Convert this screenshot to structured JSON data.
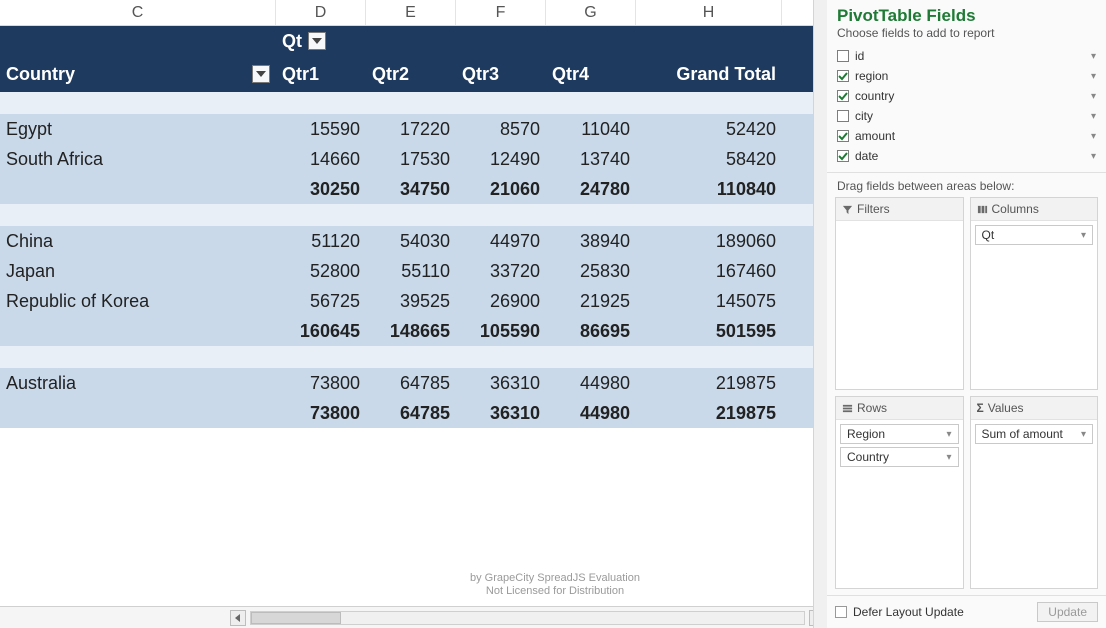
{
  "columns": {
    "C": "C",
    "D": "D",
    "E": "E",
    "F": "F",
    "G": "G",
    "H": "H"
  },
  "pivot_header": {
    "qt_label": "Qt",
    "row_field": "Country",
    "cols": {
      "q1": "Qtr1",
      "q2": "Qtr2",
      "q3": "Qtr3",
      "q4": "Qtr4",
      "total": "Grand Total"
    }
  },
  "groups": [
    {
      "rows": [
        {
          "label": "Egypt",
          "q1": "15590",
          "q2": "17220",
          "q3": "8570",
          "q4": "11040",
          "total": "52420"
        },
        {
          "label": "South Africa",
          "q1": "14660",
          "q2": "17530",
          "q3": "12490",
          "q4": "13740",
          "total": "58420"
        }
      ],
      "subtotal": {
        "q1": "30250",
        "q2": "34750",
        "q3": "21060",
        "q4": "24780",
        "total": "110840"
      }
    },
    {
      "rows": [
        {
          "label": "China",
          "q1": "51120",
          "q2": "54030",
          "q3": "44970",
          "q4": "38940",
          "total": "189060"
        },
        {
          "label": "Japan",
          "q1": "52800",
          "q2": "55110",
          "q3": "33720",
          "q4": "25830",
          "total": "167460"
        },
        {
          "label": "Republic of Korea",
          "q1": "56725",
          "q2": "39525",
          "q3": "26900",
          "q4": "21925",
          "total": "145075"
        }
      ],
      "subtotal": {
        "q1": "160645",
        "q2": "148665",
        "q3": "105590",
        "q4": "86695",
        "total": "501595"
      }
    },
    {
      "rows": [
        {
          "label": "Australia",
          "q1": "73800",
          "q2": "64785",
          "q3": "36310",
          "q4": "44980",
          "total": "219875"
        }
      ],
      "subtotal": {
        "q1": "73800",
        "q2": "64785",
        "q3": "36310",
        "q4": "44980",
        "total": "219875"
      }
    }
  ],
  "watermark": {
    "line1": "by GrapeCity SpreadJS Evaluation",
    "line2": "Not Licensed for Distribution"
  },
  "panel": {
    "title": "PivotTable Fields",
    "subtitle": "Choose fields to add to report",
    "fields": [
      {
        "name": "id",
        "checked": false
      },
      {
        "name": "region",
        "checked": true
      },
      {
        "name": "country",
        "checked": true
      },
      {
        "name": "city",
        "checked": false
      },
      {
        "name": "amount",
        "checked": true
      },
      {
        "name": "date",
        "checked": true
      }
    ],
    "drag_label": "Drag fields between areas below:",
    "areas": {
      "filters": {
        "label": "Filters",
        "items": []
      },
      "columns": {
        "label": "Columns",
        "items": [
          "Qt"
        ]
      },
      "rows": {
        "label": "Rows",
        "items": [
          "Region",
          "Country"
        ]
      },
      "values": {
        "label": "Values",
        "items": [
          "Sum of amount"
        ]
      }
    },
    "defer_label": "Defer Layout Update",
    "update_label": "Update"
  }
}
